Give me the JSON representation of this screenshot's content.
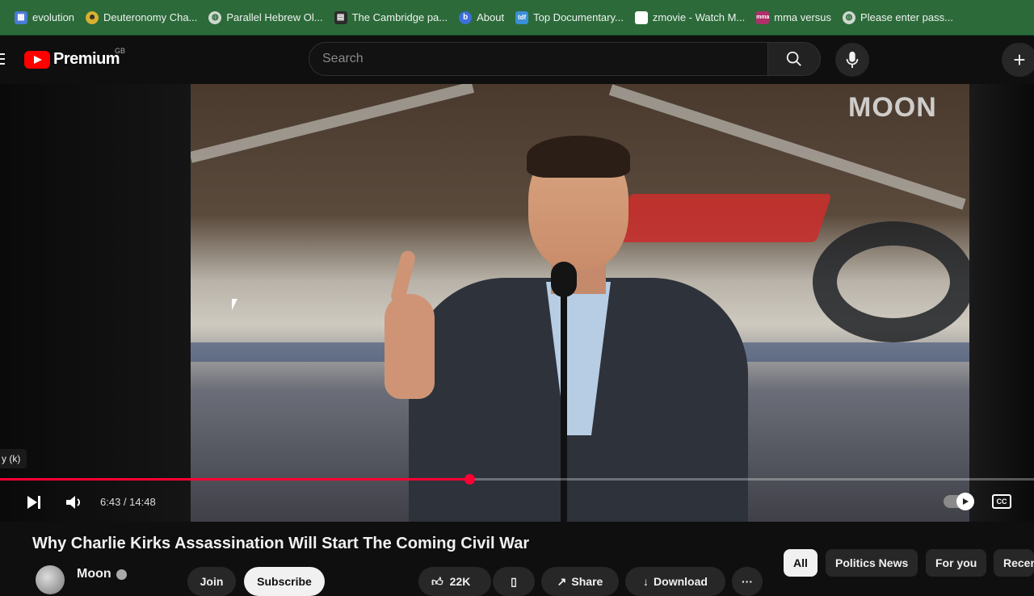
{
  "bookmarks": [
    {
      "label": "evolution",
      "icon": "grid-icon",
      "color": "#4a7bd6"
    },
    {
      "label": "Deuteronomy Cha...",
      "icon": "globe-icon",
      "color": "#d8b030"
    },
    {
      "label": "Parallel Hebrew Ol...",
      "icon": "globe-icon",
      "color": "#cfd8cf"
    },
    {
      "label": "The Cambridge pa...",
      "icon": "document-icon",
      "color": "#2b2b2b"
    },
    {
      "label": "About",
      "icon": "b-logo-icon",
      "color": "#3c6fd8"
    },
    {
      "label": "Top Documentary...",
      "icon": "tdf-logo-icon",
      "color": "#3a8fd6"
    },
    {
      "label": "zmovie - Watch M...",
      "icon": "blank-page-icon",
      "color": "#ffffff"
    },
    {
      "label": "mma versus",
      "icon": "mma-logo-icon",
      "color": "#b0306a"
    },
    {
      "label": "Please enter pass...",
      "icon": "globe-icon",
      "color": "#cfd8cf"
    }
  ],
  "header": {
    "logo_text": "Premium",
    "country_code": "GB",
    "search_placeholder": "Search",
    "create_symbol": "+"
  },
  "player": {
    "watermark": "MOON",
    "tooltip": "y (k)",
    "current_time": "6:43",
    "duration": "14:48",
    "time_display": "6:43 / 14:48",
    "progress_fraction": 0.454,
    "cc_label": "CC",
    "accent_color": "#ff0033"
  },
  "video": {
    "title": "Why Charlie Kirks Assassination Will Start The Coming Civil War",
    "channel": "Moon",
    "join_label": "Join",
    "subscribe_label": "Subscribe",
    "likes": "22K",
    "share_label": "Share",
    "download_label": "Download",
    "more_symbol": "···"
  },
  "chips": [
    {
      "label": "All",
      "active": true
    },
    {
      "label": "Politics News",
      "active": false
    },
    {
      "label": "For you",
      "active": false
    },
    {
      "label": "Recen",
      "active": false
    }
  ]
}
